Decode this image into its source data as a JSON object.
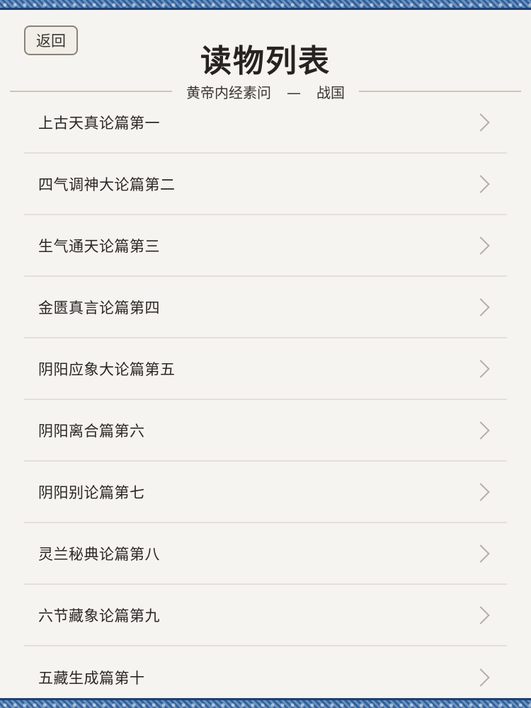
{
  "header": {
    "back_label": "返回",
    "title": "读物列表",
    "book": "黄帝内经素问",
    "dash": "—",
    "era": "战国"
  },
  "chapters": [
    {
      "label": "上古天真论篇第一"
    },
    {
      "label": "四气调神大论篇第二"
    },
    {
      "label": "生气通天论篇第三"
    },
    {
      "label": "金匮真言论篇第四"
    },
    {
      "label": "阴阳应象大论篇第五"
    },
    {
      "label": "阴阳离合篇第六"
    },
    {
      "label": "阴阳别论篇第七"
    },
    {
      "label": "灵兰秘典论篇第八"
    },
    {
      "label": "六节藏象论篇第九"
    },
    {
      "label": "五藏生成篇第十"
    }
  ],
  "icons": {
    "row_chevron": "chevron-right-icon"
  },
  "colors": {
    "border_blue": "#3b6ea8",
    "background": "#f6f4f0",
    "divider": "#cfc6b4"
  }
}
